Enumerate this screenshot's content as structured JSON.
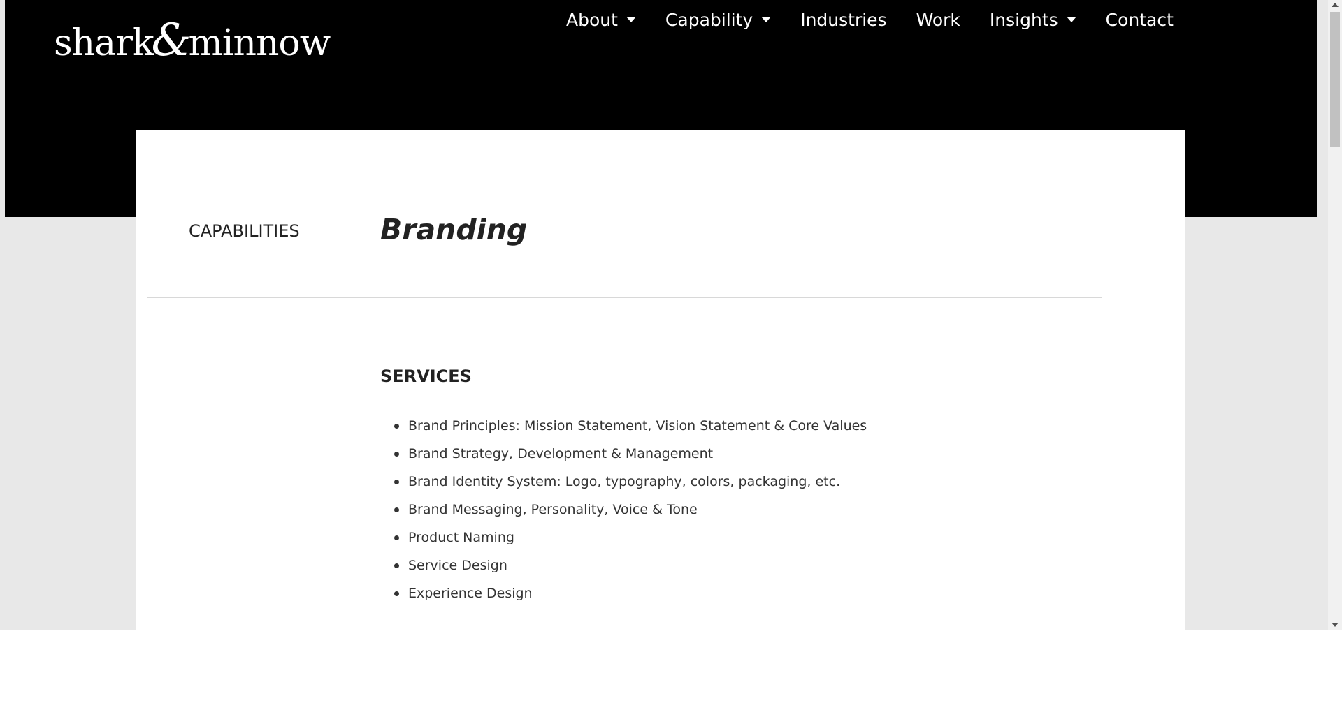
{
  "header": {
    "logo": {
      "part1": "shark",
      "amp": "&",
      "part2": "minnow"
    },
    "nav": [
      {
        "label": "About",
        "dropdown": true
      },
      {
        "label": "Capability",
        "dropdown": true
      },
      {
        "label": "Industries",
        "dropdown": false
      },
      {
        "label": "Work",
        "dropdown": false
      },
      {
        "label": "Insights",
        "dropdown": true
      },
      {
        "label": "Contact",
        "dropdown": false
      }
    ]
  },
  "main": {
    "section_label": "CAPABILITIES",
    "title": "Branding",
    "services_heading": "SERVICES",
    "services": [
      "Brand Principles: Mission Statement, Vision Statement & Core Values",
      "Brand Strategy, Development & Management",
      "Brand Identity System: Logo, typography, colors, packaging, etc.",
      "Brand Messaging, Personality, Voice & Tone",
      "Product Naming",
      "Service Design",
      "Experience Design"
    ]
  },
  "colors": {
    "header_bg": "#000000",
    "page_bg": "#e8e8e8",
    "card_bg": "#ffffff",
    "text": "#222222"
  }
}
